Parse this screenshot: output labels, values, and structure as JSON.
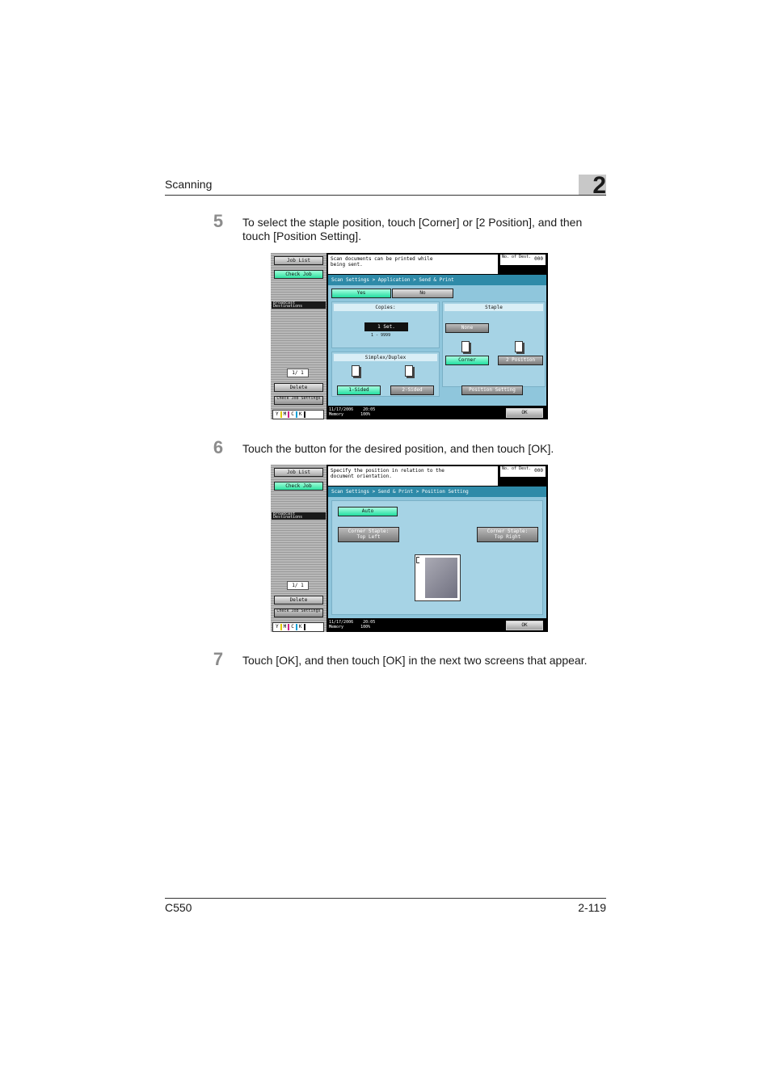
{
  "header": {
    "section_title": "Scanning",
    "chapter_number": "2"
  },
  "footer": {
    "model": "C550",
    "page_number": "2-119"
  },
  "steps": [
    {
      "number": "5",
      "text_line1": "To select the staple position, touch [Corner] or [2 Position], and then",
      "text_line2": "touch [Position Setting]."
    },
    {
      "number": "6",
      "text": "Touch the button for the desired position, and then touch [OK]."
    },
    {
      "number": "7",
      "text": "Touch [OK], and then touch [OK] in the next two screens that appear."
    }
  ],
  "screen1": {
    "side": {
      "job_list": "Job List",
      "check_job": "Check Job",
      "dest_label": "Broadcast Destinations",
      "page": "1/ 1",
      "delete": "Delete",
      "check_job_settings": "Check Job Settings",
      "toner": [
        "Y",
        "M",
        "C",
        "K"
      ]
    },
    "message_line1": "Scan documents can be printed while",
    "message_line2": "being sent.",
    "counter": {
      "label": "No. of Dest.",
      "value": "000"
    },
    "breadcrumb": "Scan Settings > Application > Send & Print",
    "yes": "Yes",
    "no": "No",
    "copies": {
      "title": "Copies:",
      "value": "1 Set.",
      "range": "1  -  9999"
    },
    "staple": {
      "title": "Staple",
      "none": "None",
      "corner": "Corner",
      "two_position": "2 Position",
      "position_setting": "Position Setting"
    },
    "simplex": {
      "title": "Simplex/Duplex",
      "one_sided": "1-Sided",
      "two_sided": "2-Sided"
    },
    "status": {
      "date": "11/17/2006",
      "time": "20:05",
      "memory_label": "Memory",
      "memory_value": "100%"
    },
    "ok": "OK"
  },
  "screen2": {
    "side": {
      "job_list": "Job List",
      "check_job": "Check Job",
      "dest_label": "Broadcast Destinations",
      "page": "1/ 1",
      "delete": "Delete",
      "check_job_settings": "Check Job Settings",
      "toner": [
        "Y",
        "M",
        "C",
        "K"
      ]
    },
    "message_line1": "Specify the position in relation to the",
    "message_line2": "document orientation.",
    "counter": {
      "label": "No. of Dest.",
      "value": "000"
    },
    "breadcrumb": "Scan Settings > Send & Print > Position Setting",
    "auto": "Auto",
    "top_left_line1": "Corner Staple:",
    "top_left_line2": "Top Left",
    "top_right_line1": "Corner Staple:",
    "top_right_line2": "Top Right",
    "status": {
      "date": "11/17/2006",
      "time": "20:05",
      "memory_label": "Memory",
      "memory_value": "100%"
    },
    "ok": "OK"
  },
  "colors": {
    "panel_blue": "#8fc6dc",
    "title_bar": "#2e8aa8",
    "active_green": "#22dda0",
    "step_gray": "#8c8c8c"
  }
}
